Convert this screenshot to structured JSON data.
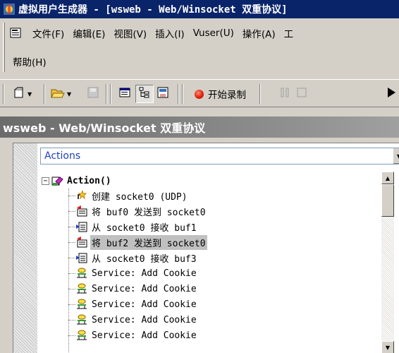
{
  "window": {
    "title": "虚拟用户生成器 - [wsweb - Web/Winsocket 双重协议]"
  },
  "menu": {
    "items": [
      "文件(F)",
      "编辑(E)",
      "视图(V)",
      "插入(I)",
      "Vuser(U)",
      "操作(A)",
      "工"
    ],
    "items_row2": [
      "帮助(H)"
    ]
  },
  "toolbar": {
    "record_label": "开始录制"
  },
  "document": {
    "header": "wsweb - Web/Winsocket 双重协议",
    "section_selector": "Actions"
  },
  "tree": {
    "root": "Action()",
    "children": [
      {
        "label": "创建 socket0 (UDP)",
        "icon": "create-socket-icon"
      },
      {
        "label": "将 buf0 发送到 socket0",
        "icon": "send-buffer-icon"
      },
      {
        "label": "从 socket0 接收 buf1",
        "icon": "receive-buffer-icon"
      },
      {
        "label": "将 buf2 发送到 socket0",
        "icon": "send-buffer-icon",
        "selected": true
      },
      {
        "label": "从 socket0 接收 buf3",
        "icon": "receive-buffer-icon"
      },
      {
        "label": "Service: Add Cookie",
        "icon": "service-icon"
      },
      {
        "label": "Service: Add Cookie",
        "icon": "service-icon"
      },
      {
        "label": "Service: Add Cookie",
        "icon": "service-icon"
      },
      {
        "label": "Service: Add Cookie",
        "icon": "service-icon"
      },
      {
        "label": "Service: Add Cookie",
        "icon": "service-icon"
      }
    ]
  },
  "colors": {
    "title_bar": "#0a246a",
    "header_gradient": "#6b6b6b",
    "selection": "#c0c0c0",
    "combo_text": "#1f3fc0"
  }
}
